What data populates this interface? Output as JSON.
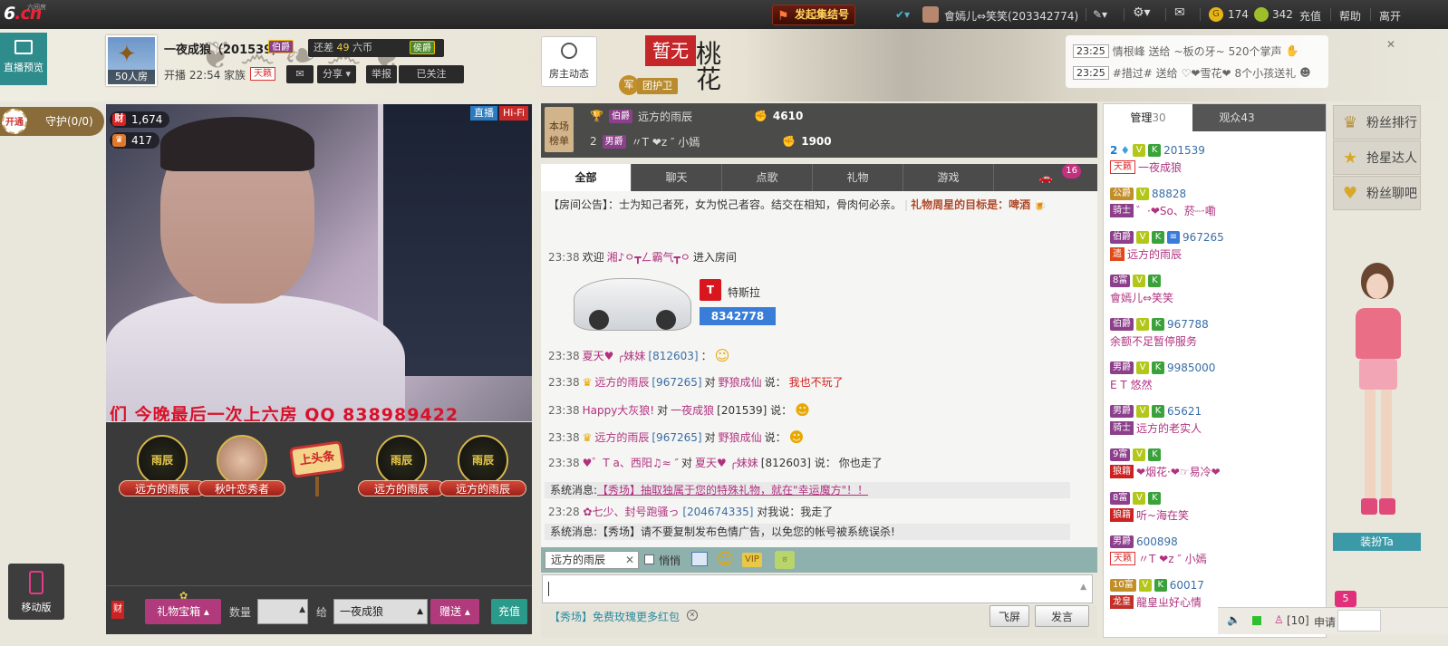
{
  "topbar": {
    "logo_main": "6",
    "logo_sub": ".cn",
    "logo_small": "六间房",
    "quick_btn": "发起集结号",
    "user": "會嫣儿⇔笑笑(203342774)",
    "coins": "174",
    "beans": "342",
    "recharge": "充值",
    "help": "帮助",
    "leave": "离开"
  },
  "room": {
    "preview": "直播预览",
    "viewers": "50人房",
    "host_name": "一夜成狼（201539）",
    "host_badge": "伯爵",
    "gap_label": "还差",
    "gap_value": "49",
    "coin_label": "六币",
    "coin_badge": "侯爵",
    "start_time": "开播 22:54",
    "family": "家族",
    "family_tag": "天籁",
    "share": "分享",
    "report": "举报",
    "followed": "已关注",
    "host_dynamic": "房主动态",
    "nonetext": "暂无",
    "tuan": "团护卫",
    "jun": "军",
    "guard": "守护(0/0)",
    "open": "开通"
  },
  "gifts_ticker": [
    {
      "time": "23:25",
      "text": "情根峰 送给",
      "target": "~板の牙~",
      "gift": "520个掌声"
    },
    {
      "time": "23:25",
      "text": "#措过# 送给",
      "target": "♡❤雪花❤",
      "gift": "8个小孩送礼"
    }
  ],
  "video": {
    "wealth": "1,674",
    "fans": "417",
    "tag1": "直播",
    "tag2": "Hi-Fi",
    "caption": "们 今晚最后一次上六房 QQ 838989422"
  },
  "fans": [
    {
      "name": "远方的雨辰",
      "char": "雨辰"
    },
    {
      "name": "秋叶恋秀者",
      "char": ""
    },
    {
      "name": "远方的雨辰",
      "char": "雨辰"
    },
    {
      "name": "远方的雨辰",
      "char": "雨辰"
    }
  ],
  "toutiao": "上头条",
  "bottom": {
    "cai": "财",
    "giftbox": "礼物宝箱",
    "qty_label": "数量",
    "to_label": "给",
    "to_value": "一夜成狼",
    "send": "赠送",
    "recharge": "充值",
    "mobile": "移动版"
  },
  "rank": {
    "title": "本场榜单",
    "rows": [
      {
        "num": "1",
        "badge": "伯爵",
        "name": "远方的雨辰",
        "score": "4610"
      },
      {
        "num": "2",
        "badge": "男爵",
        "name": "〃T ❤z ″ 小嫣",
        "score": "1900"
      }
    ]
  },
  "tabs": [
    "全部",
    "聊天",
    "点歌",
    "礼物",
    "游戏"
  ],
  "tabcount": "16",
  "chat": {
    "notice": "【房间公告】：士为知己者死，女为悦己者容。结交在相知，骨肉何必亲。",
    "notice_star": "礼物周星的目标是：啤酒",
    "welcome_time": "23:38",
    "welcome_pre": "欢迎",
    "welcome_name": "湘♪ㅇ┳ㄥ霸气┳ㅇ",
    "welcome_post": "进入房间",
    "car_name": "特斯拉",
    "car_num": "8342778",
    "lines": [
      {
        "time": "23:38",
        "from": "夏天♥ ╭妹妹",
        "id": "[812603]",
        "mid": "：",
        "to": "",
        "say": "",
        "msg": ""
      },
      {
        "time": "23:38",
        "from": "远方的雨辰",
        "id": "[967265]",
        "mid": "对",
        "to": "野狼成仙",
        "say": "说：",
        "msg": "我也不玩了"
      },
      {
        "time": "23:38",
        "from": "Happy大灰狼!",
        "id": "",
        "mid": "对",
        "to": "一夜成狼",
        "say": "[201539] 说：",
        "msg": ""
      },
      {
        "time": "23:38",
        "from": "远方的雨辰",
        "id": "[967265]",
        "mid": "对",
        "to": "野狼成仙",
        "say": "说：",
        "msg": ""
      },
      {
        "time": "23:38",
        "from": "♥゛T a、西阳♫≈ ″",
        "id": "",
        "mid": "对",
        "to": "夏天♥ ╭妹妹",
        "say": "[812603] 说：",
        "msg": "你也走了"
      }
    ],
    "sys1_label": "系统消息:",
    "sys1_text": "【秀场】抽取独属于您的特殊礼物，就在\"幸运魔方\"！！",
    "line6_time": "23:28",
    "line6_from": "✿七少、封号跑骚っ",
    "line6_id": "[204674335]",
    "line6_text": "对我说：我走了",
    "sys2_label": "系统消息:",
    "sys2_text": "【秀场】请不要复制发布色情广告，以免您的帐号被系统误杀!"
  },
  "input": {
    "target": "远方的雨辰",
    "whisper": "悄悄",
    "fly": "飞屏",
    "send": "发言",
    "promo": "【秀场】免费玫瑰更多红包"
  },
  "right": {
    "tab_admin": "管理",
    "admin_count": "30",
    "tab_viewers": "观众",
    "viewer_count": "43",
    "users": [
      {
        "lv": "2",
        "tag": "天籁",
        "id": "201539",
        "name": "一夜成狼"
      },
      {
        "lv": "公爵",
        "tag": "骑士",
        "id": "88828",
        "name": "゛·❤So、菸┈·嘞"
      },
      {
        "lv": "伯爵",
        "tag": "遗",
        "id": "967265",
        "name": "远方的雨辰"
      },
      {
        "lv": "8富",
        "tag": "",
        "id": "",
        "name": "會嫣儿⇔笑笑"
      },
      {
        "lv": "伯爵",
        "tag": "",
        "id": "967788",
        "name": "余额不足暂停服务"
      },
      {
        "lv": "男爵",
        "tag": "",
        "id": "9985000",
        "name": "E T 悠然"
      },
      {
        "lv": "男爵",
        "tag": "骑士",
        "id": "65621",
        "name": "远方的老实人"
      },
      {
        "lv": "9富",
        "tag": "狼籍",
        "id": "",
        "name": "❤烟花·❤☞易冷❤"
      },
      {
        "lv": "8富",
        "tag": "狼籍",
        "id": "",
        "name": "听~海在笑"
      },
      {
        "lv": "男爵",
        "tag": "天籁",
        "id": "600898",
        "name": "〃T ❤z ″ 小嫣"
      },
      {
        "lv": "10富",
        "tag": "龙皇",
        "id": "60017",
        "name": "龍皇ㄓ好心情"
      }
    ]
  },
  "side": {
    "rank": "粉丝排行",
    "star": "抢星达人",
    "chat": "粉丝聊吧",
    "dress": "装扮Ta",
    "apply": "申请",
    "online": "[10]",
    "badge5": "5"
  }
}
